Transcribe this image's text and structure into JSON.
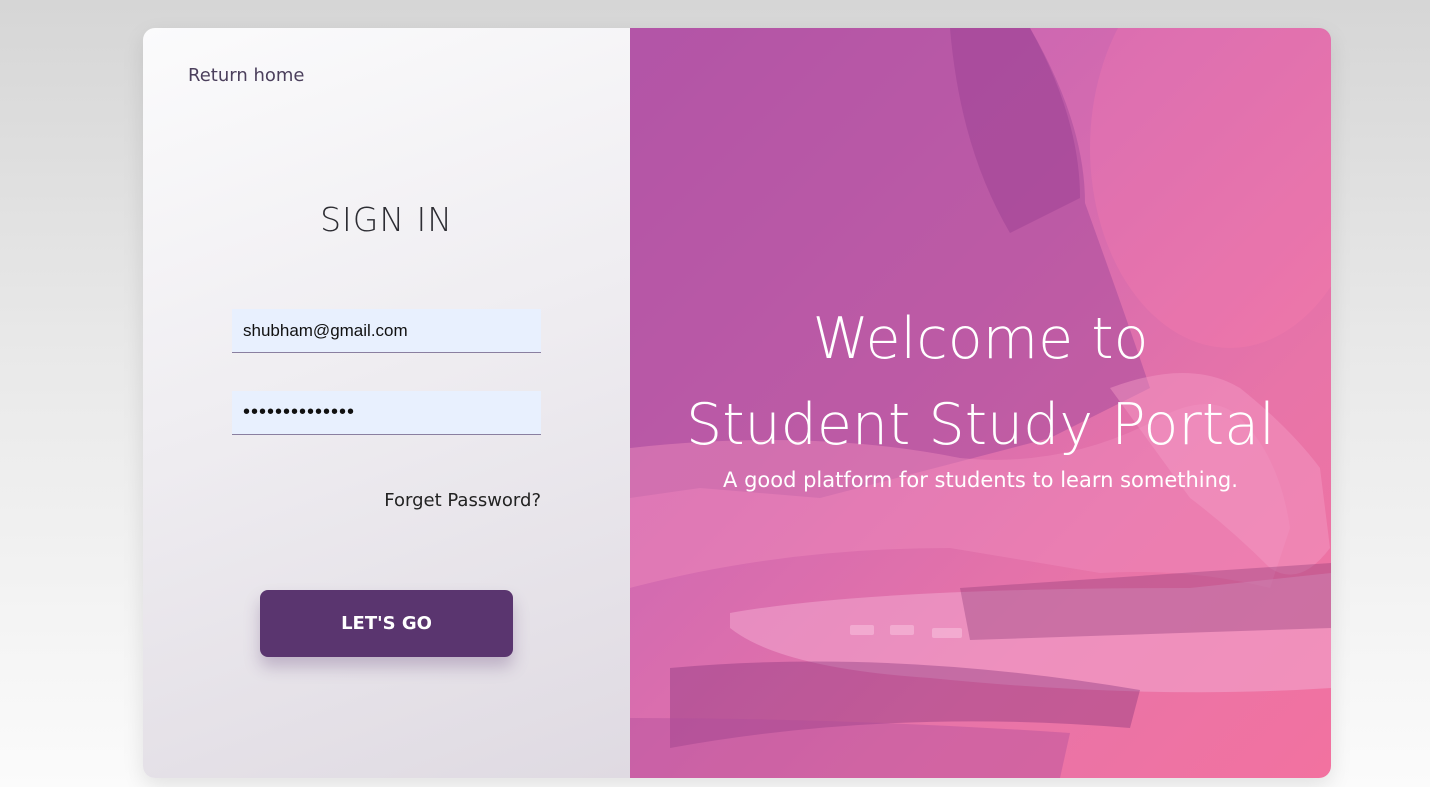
{
  "login": {
    "return_home": "Return home",
    "title": "SIGN IN",
    "email_value": "shubham@gmail.com",
    "password_value": "**************",
    "forget_password": "Forget Password?",
    "submit_label": "LET'S GO"
  },
  "hero": {
    "line1": "Welcome to",
    "line2": "Student Study Portal",
    "subtitle": "A good platform for students to learn something."
  },
  "colors": {
    "button_bg": "#5a356f",
    "input_bg": "#e8f0fe",
    "overlay_pink": "#e874a8",
    "overlay_purple": "#c05fb3"
  }
}
